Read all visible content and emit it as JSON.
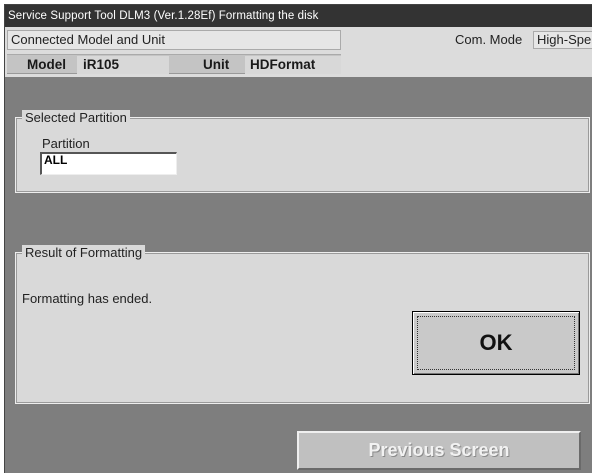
{
  "window": {
    "title": "Service Support Tool DLM3 (Ver.1.28Ef) Formatting the disk"
  },
  "info": {
    "connected_label": "Connected Model and Unit",
    "model_label": "Model",
    "model_value": "iR105",
    "unit_label": "Unit",
    "unit_value": "HDFormat",
    "com_mode_label": "Com. Mode",
    "com_mode_value": "High-Spe"
  },
  "selected_partition": {
    "group_title": "Selected Partition",
    "field_label": "Partition",
    "field_value": "ALL"
  },
  "result": {
    "group_title": "Result of Formatting",
    "message": "Formatting has ended.",
    "ok_label": "OK"
  },
  "footer": {
    "previous_label": "Previous Screen",
    "previous_enabled": false
  }
}
